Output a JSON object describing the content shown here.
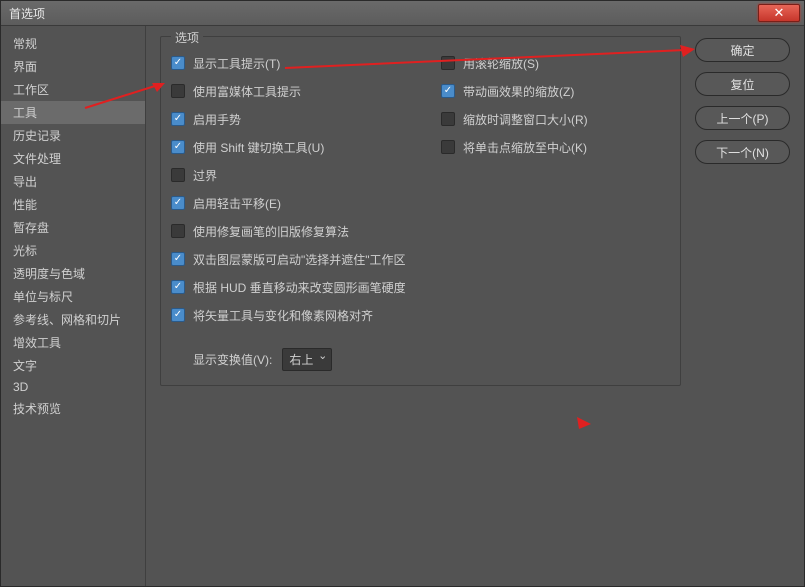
{
  "titlebar": {
    "title": "首选项"
  },
  "sidebar": {
    "items": [
      {
        "label": "常规"
      },
      {
        "label": "界面"
      },
      {
        "label": "工作区"
      },
      {
        "label": "工具"
      },
      {
        "label": "历史记录"
      },
      {
        "label": "文件处理"
      },
      {
        "label": "导出"
      },
      {
        "label": "性能"
      },
      {
        "label": "暂存盘"
      },
      {
        "label": "光标"
      },
      {
        "label": "透明度与色域"
      },
      {
        "label": "单位与标尺"
      },
      {
        "label": "参考线、网格和切片"
      },
      {
        "label": "增效工具"
      },
      {
        "label": "文字"
      },
      {
        "label": "3D"
      },
      {
        "label": "技术预览"
      }
    ],
    "selected_index": 3
  },
  "panel": {
    "title": "选项"
  },
  "options_left": [
    {
      "label": "显示工具提示(T)",
      "checked": true
    },
    {
      "label": "使用富媒体工具提示",
      "checked": false
    },
    {
      "label": "启用手势",
      "checked": true
    },
    {
      "label": "使用 Shift 键切换工具(U)",
      "checked": true
    },
    {
      "label": "过界",
      "checked": false
    },
    {
      "label": "启用轻击平移(E)",
      "checked": true
    },
    {
      "label": "使用修复画笔的旧版修复算法",
      "checked": false
    },
    {
      "label": "双击图层蒙版可启动\"选择并遮住\"工作区",
      "checked": true
    },
    {
      "label": "根据 HUD 垂直移动来改变圆形画笔硬度",
      "checked": true
    },
    {
      "label": "将矢量工具与变化和像素网格对齐",
      "checked": true
    }
  ],
  "options_right": [
    {
      "label": "用滚轮缩放(S)",
      "checked": false
    },
    {
      "label": "带动画效果的缩放(Z)",
      "checked": true
    },
    {
      "label": "缩放时调整窗口大小(R)",
      "checked": false
    },
    {
      "label": "将单击点缩放至中心(K)",
      "checked": false
    }
  ],
  "transform": {
    "label": "显示变换值(V):",
    "value": "右上"
  },
  "buttons": {
    "ok": "确定",
    "reset": "复位",
    "prev": "上一个(P)",
    "next": "下一个(N)"
  }
}
